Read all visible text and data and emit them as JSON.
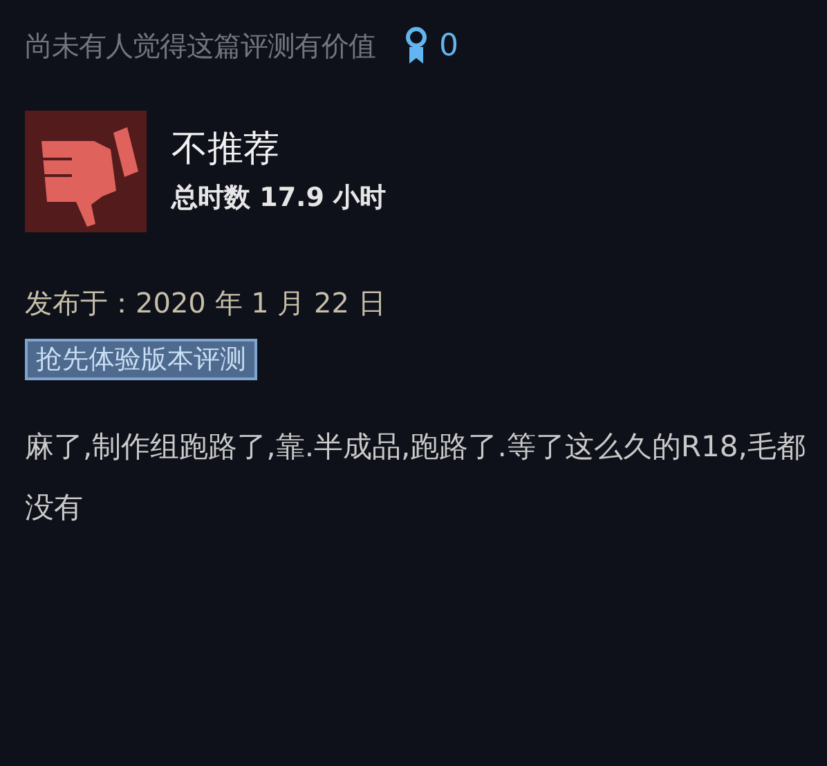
{
  "helpful_notice": "尚未有人觉得这篇评测有价值",
  "award_count": "0",
  "review": {
    "recommended": false,
    "verdict": "不推荐",
    "hours": "总时数 17.9 小时"
  },
  "posted": "发布于：2020 年 1 月 22 日",
  "tag": "抢先体验版本评测",
  "body": "麻了,制作组跑路了,靠.半成品,跑路了.等了这么久的R18,毛都没有"
}
